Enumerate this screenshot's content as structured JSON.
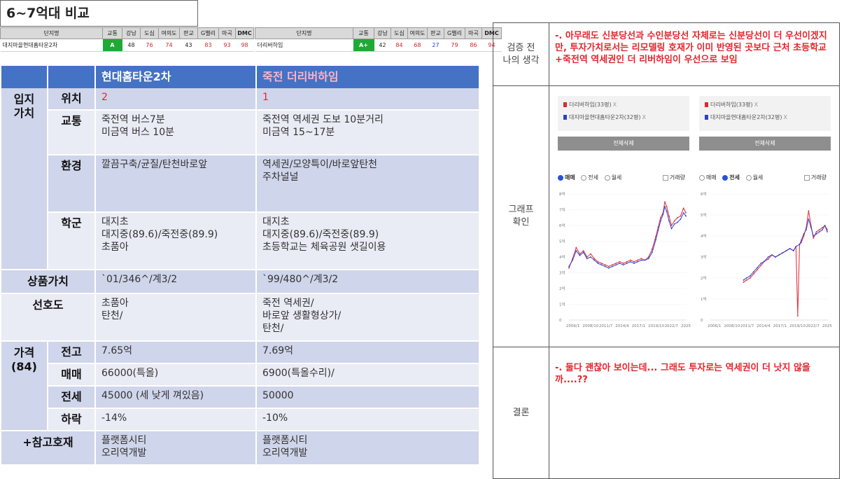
{
  "title": "6~7억대 비교",
  "strip_headers": [
    "단지명",
    "교통",
    "강남",
    "도심",
    "여의도",
    "판교",
    "G밸리",
    "마곡",
    "DMC"
  ],
  "strip_left": {
    "name": "대지마을현대홈타운2차",
    "grade": "A",
    "scores": [
      {
        "v": "48",
        "c": "black"
      },
      {
        "v": "76",
        "c": "red"
      },
      {
        "v": "74",
        "c": "red"
      },
      {
        "v": "43",
        "c": "black"
      },
      {
        "v": "83",
        "c": "red"
      },
      {
        "v": "93",
        "c": "red"
      },
      {
        "v": "98",
        "c": "red"
      }
    ]
  },
  "strip_right": {
    "name": "더리버하임",
    "grade": "A+",
    "scores": [
      {
        "v": "42",
        "c": "black"
      },
      {
        "v": "84",
        "c": "red"
      },
      {
        "v": "68",
        "c": "red"
      },
      {
        "v": "27",
        "c": "blue"
      },
      {
        "v": "79",
        "c": "red"
      },
      {
        "v": "86",
        "c": "red"
      },
      {
        "v": "94",
        "c": "red"
      }
    ]
  },
  "compare": {
    "col_a": "현대홈타운2차",
    "col_b": "죽전 더리버하임",
    "ipji_label": "입지\n가치",
    "rows_ipji": [
      {
        "label": "위치",
        "a": "2",
        "b": "1"
      },
      {
        "label": "교통",
        "a": "죽전역 버스7분\n미금역 버스 10분",
        "b": "죽전역 역세권 도보 10분거리\n미금역 15~17분"
      },
      {
        "label": "환경",
        "a": "깔끔구축/균질/탄천바로앞",
        "b": "역세권/모양특이/바로앞탄천\n주차널널"
      },
      {
        "label": "학군",
        "a": "대지초\n대지중(89.6)/죽전중(89.9)\n초품아",
        "b": "대지초\n대지중(89.6)/죽전중(89.9)\n초등학교는 체육공원 샛길이용"
      }
    ],
    "product": {
      "label": "상품가치",
      "a": "`01/346^/계3/2",
      "b": "`99/480^/계3/2"
    },
    "preference": {
      "label": "선호도",
      "a": "초품아\n탄천/",
      "b": "죽전 역세권/\n바로앞 생활형상가/\n탄천/"
    },
    "price_label": "가격\n(84)",
    "rows_price": [
      {
        "label": "전고",
        "a": "7.65억",
        "b": "7.69억"
      },
      {
        "label": "매매",
        "a": "66000(특올)",
        "b": "6900(특올수리)/"
      },
      {
        "label": "전세",
        "a": "45000 (세 낮게 껴있음)",
        "b": "50000"
      },
      {
        "label": "하락",
        "a": "-14%",
        "b": "-10%"
      }
    ],
    "reference": {
      "label": "+참고호재",
      "a": "플랫폼시티\n오리역개발",
      "b": "플랫폼시티\n오리역개발"
    }
  },
  "right_panel": {
    "pre_label": "검증 전\n나의 생각",
    "pre_text": "-. 아무래도 신분당선과 수인분당선 자체로는 신분당선이 더 우선이겠지만, 투자가치로서는 리모델링 호재가 이미 반영된 곳보다 근처 초등학교+죽전역 역세권인 더 리버하임이 우선으로 보임",
    "graph_label": "그래프\n확인",
    "conclusion_label": "결론",
    "conclusion_text": "-. 둘다 괜찮아 보이는데... 그래도 투자로는 역세권이 더 낫지 않을까....??"
  },
  "graph_ui": {
    "legend_a": "더리버하임(33평)",
    "legend_b": "대지마을현대홈타운2차(32평)",
    "legend_x": "X",
    "delete_all": "전체삭제",
    "radio_sale": "매매",
    "radio_jeonse": "전세",
    "radio_monthly": "월세",
    "volume": "거래량",
    "colors": {
      "red": "#e0262d",
      "blue": "#2a3fd0"
    }
  },
  "chart_data": [
    {
      "type": "line",
      "title": "",
      "mode": "매매",
      "x_ticks": [
        "2006/1",
        "2008/10",
        "2011/7",
        "2014/4",
        "2017/1",
        "2019/10",
        "2022/7",
        "2025/4"
      ],
      "y_ticks": [
        "0",
        "1억",
        "2억",
        "3억",
        "4억",
        "5억",
        "6억",
        "7억",
        "8억"
      ],
      "ylim": [
        0,
        8
      ],
      "xlim": [
        2006.0,
        2025.5
      ],
      "series": [
        {
          "name": "더리버하임(33평)",
          "color": "#e0262d",
          "x": [
            2006.0,
            2006.6,
            2007.2,
            2007.8,
            2008.4,
            2009.0,
            2009.6,
            2010.2,
            2010.8,
            2011.4,
            2012.0,
            2012.6,
            2013.2,
            2013.8,
            2014.4,
            2015.0,
            2015.6,
            2016.2,
            2016.8,
            2017.4,
            2018.0,
            2018.6,
            2019.2,
            2019.8,
            2020.4,
            2020.8,
            2021.2,
            2021.6,
            2021.9,
            2022.2,
            2022.6,
            2023.0,
            2023.5,
            2024.0,
            2024.5,
            2025.0,
            2025.4
          ],
          "y": [
            3.3,
            3.9,
            4.6,
            4.2,
            4.4,
            4.0,
            4.2,
            3.9,
            3.7,
            3.6,
            3.5,
            3.4,
            3.5,
            3.6,
            3.7,
            3.6,
            3.7,
            3.8,
            3.7,
            3.8,
            3.9,
            3.8,
            4.0,
            4.5,
            5.3,
            5.9,
            6.5,
            6.8,
            7.5,
            7.2,
            6.6,
            6.0,
            6.3,
            6.5,
            6.6,
            7.1,
            6.8
          ]
        },
        {
          "name": "대지마을현대홈타운2차(32평)",
          "color": "#2a3fd0",
          "x": [
            2006.0,
            2006.6,
            2007.2,
            2007.8,
            2008.4,
            2009.0,
            2009.6,
            2010.2,
            2010.8,
            2011.4,
            2012.0,
            2012.6,
            2013.2,
            2013.8,
            2014.4,
            2015.0,
            2015.6,
            2016.2,
            2016.8,
            2017.4,
            2018.0,
            2018.6,
            2019.2,
            2019.8,
            2020.4,
            2020.8,
            2021.2,
            2021.6,
            2021.9,
            2022.2,
            2022.6,
            2023.0,
            2023.5,
            2024.0,
            2024.5,
            2025.0,
            2025.4
          ],
          "y": [
            3.4,
            3.8,
            4.4,
            4.1,
            4.3,
            3.9,
            4.0,
            3.8,
            3.6,
            3.5,
            3.4,
            3.3,
            3.4,
            3.5,
            3.6,
            3.5,
            3.6,
            3.7,
            3.6,
            3.7,
            3.8,
            3.8,
            3.9,
            4.3,
            5.1,
            5.7,
            6.3,
            6.7,
            7.2,
            6.9,
            6.3,
            5.8,
            6.1,
            6.2,
            6.4,
            6.8,
            6.6
          ]
        }
      ]
    },
    {
      "type": "line",
      "title": "",
      "mode": "전세",
      "x_ticks": [
        "2006/1",
        "2008/10",
        "2011/7",
        "2014/4",
        "2017/1",
        "2019/10",
        "2022/7",
        "2025/4"
      ],
      "y_ticks": [
        "0",
        "1억",
        "2억",
        "3억",
        "4억",
        "5억",
        "6억"
      ],
      "ylim": [
        0,
        6
      ],
      "xlim": [
        2006.0,
        2025.5
      ],
      "series": [
        {
          "name": "더리버하임(33평)",
          "color": "#e0262d",
          "x": [
            2011.5,
            2012.0,
            2012.6,
            2013.2,
            2013.8,
            2014.4,
            2015.0,
            2015.6,
            2016.2,
            2016.8,
            2017.4,
            2018.0,
            2018.6,
            2019.2,
            2019.8,
            2020.2,
            2020.5,
            2020.8,
            2021.1,
            2021.5,
            2021.9,
            2022.3,
            2022.7,
            2023.1,
            2023.6,
            2024.1,
            2024.6,
            2025.0,
            2025.4
          ],
          "y": [
            1.8,
            1.9,
            2.0,
            2.2,
            2.4,
            2.6,
            2.8,
            2.9,
            3.1,
            3.0,
            3.1,
            3.2,
            3.3,
            3.4,
            3.3,
            3.5,
            0.2,
            3.6,
            3.7,
            4.0,
            4.4,
            5.2,
            4.5,
            3.9,
            4.2,
            4.3,
            4.4,
            4.5,
            4.3
          ]
        },
        {
          "name": "대지마을현대홈타운2차(32평)",
          "color": "#2a3fd0",
          "x": [
            2011.5,
            2012.0,
            2012.6,
            2013.2,
            2013.8,
            2014.4,
            2015.0,
            2015.6,
            2016.2,
            2016.8,
            2017.4,
            2018.0,
            2018.6,
            2019.2,
            2019.8,
            2020.2,
            2020.8,
            2021.1,
            2021.5,
            2021.9,
            2022.3,
            2022.7,
            2023.1,
            2023.6,
            2024.1,
            2024.6,
            2025.0,
            2025.4
          ],
          "y": [
            1.9,
            2.0,
            2.1,
            2.3,
            2.5,
            2.7,
            2.8,
            3.0,
            3.1,
            3.0,
            3.1,
            3.2,
            3.3,
            3.4,
            3.3,
            3.5,
            3.6,
            3.8,
            4.1,
            4.3,
            4.8,
            4.4,
            4.0,
            4.1,
            4.2,
            4.3,
            4.5,
            4.2
          ]
        }
      ]
    }
  ]
}
